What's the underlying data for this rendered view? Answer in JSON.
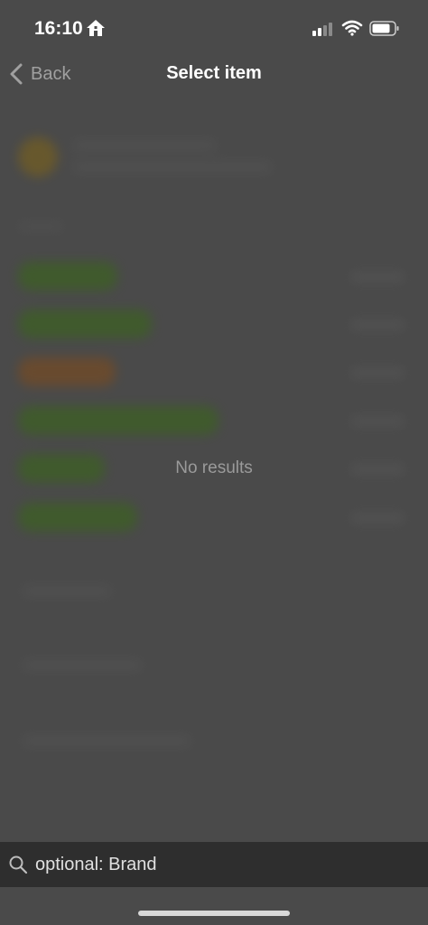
{
  "status_bar": {
    "time": "16:10",
    "icons": [
      "home-icon",
      "signal-icon",
      "wifi-icon",
      "battery-icon"
    ]
  },
  "nav": {
    "back_label": "Back",
    "title": "Select item"
  },
  "content": {
    "empty_message": "No results"
  },
  "search": {
    "placeholder": "optional: Brand",
    "value": ""
  },
  "colors": {
    "background": "#4a4a4a",
    "search_bar": "#2e2e2e",
    "text_muted": "#9a9a9a"
  }
}
